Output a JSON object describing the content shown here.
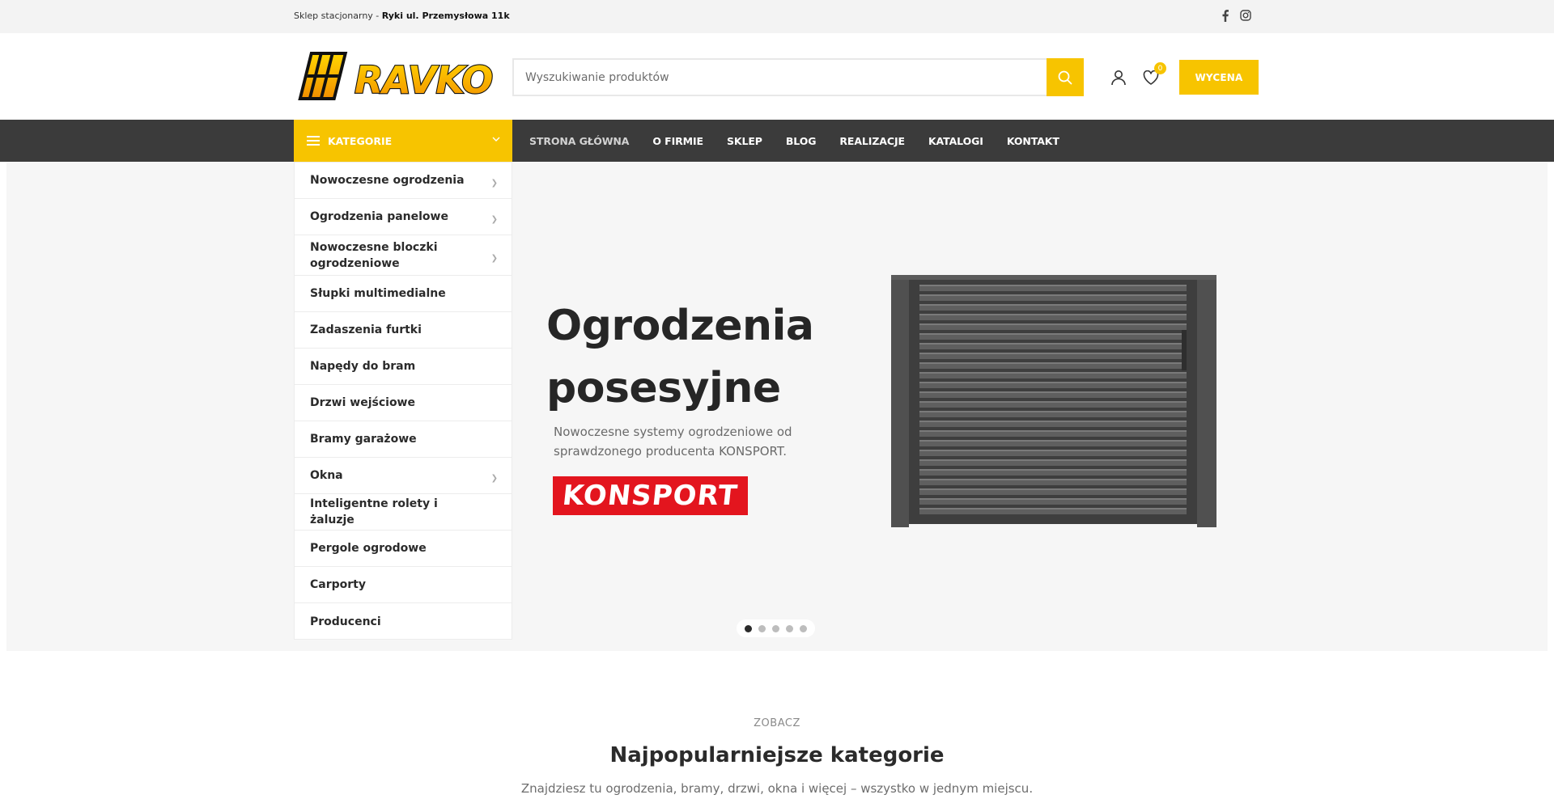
{
  "topbar": {
    "store_prefix": "Sklep stacjonarny - ",
    "store_address": "Ryki ul. Przemysłowa 11k",
    "social": [
      "facebook-icon",
      "instagram-icon"
    ]
  },
  "header": {
    "logo_text": "RAVKO",
    "search_placeholder": "Wyszukiwanie produktów",
    "wishlist_count": "0",
    "quote_label": "WYCENA"
  },
  "navbar": {
    "categories_label": "KATEGORIE",
    "menu": [
      {
        "label": "STRONA GŁÓWNA",
        "active": true
      },
      {
        "label": "O FIRMIE"
      },
      {
        "label": "SKLEP"
      },
      {
        "label": "BLOG"
      },
      {
        "label": "REALIZACJE"
      },
      {
        "label": "KATALOGI"
      },
      {
        "label": "KONTAKT"
      }
    ]
  },
  "categories": [
    {
      "label": "Nowoczesne ogrodzenia",
      "has_sub": true
    },
    {
      "label": "Ogrodzenia panelowe",
      "has_sub": true
    },
    {
      "label": "Nowoczesne bloczki ogrodzeniowe",
      "has_sub": true
    },
    {
      "label": "Słupki multimedialne",
      "has_sub": false
    },
    {
      "label": "Zadaszenia furtki",
      "has_sub": false
    },
    {
      "label": "Napędy do bram",
      "has_sub": false
    },
    {
      "label": "Drzwi wejściowe",
      "has_sub": false
    },
    {
      "label": "Bramy garażowe",
      "has_sub": false
    },
    {
      "label": "Okna",
      "has_sub": true
    },
    {
      "label": "Inteligentne rolety i żaluzje",
      "has_sub": false
    },
    {
      "label": "Pergole ogrodowe",
      "has_sub": false
    },
    {
      "label": "Carporty",
      "has_sub": false
    },
    {
      "label": "Producenci",
      "has_sub": false
    }
  ],
  "hero": {
    "title_line1": "Ogrodzenia",
    "title_line2": "posesyjne",
    "subtitle": "Nowoczesne systemy ogrodzeniowe od sprawdzonego producenta KONSPORT.",
    "brand_logo": "KONSPORT",
    "slides_total": 5,
    "slide_active": 1
  },
  "section": {
    "kicker": "ZOBACZ",
    "title": "Najpopularniejsze kategorie",
    "description": "Znajdziesz tu ogrodzenia, bramy, drzwi, okna i więcej – wszystko w jednym miejscu."
  },
  "colors": {
    "accent": "#f7c400",
    "nav_bg": "#3b3b3b",
    "brand_red": "#e3151e"
  }
}
